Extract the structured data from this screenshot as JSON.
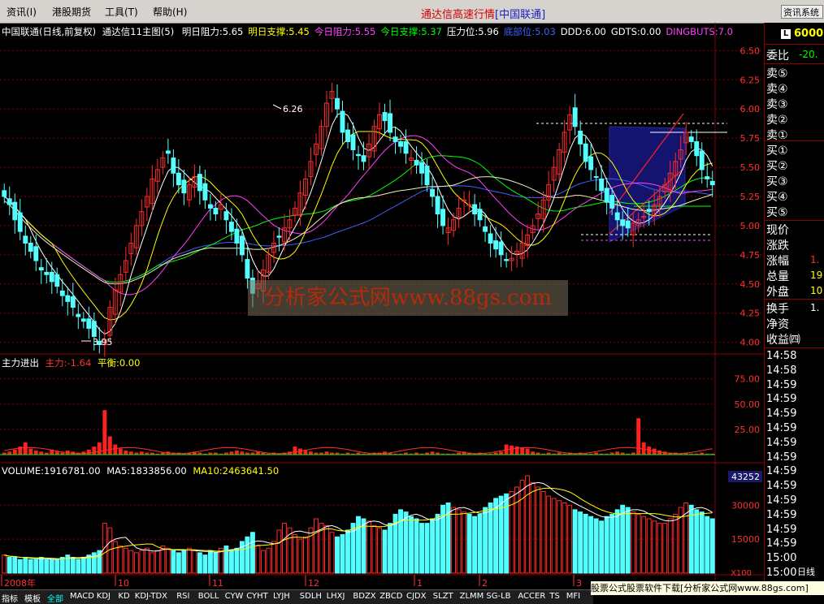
{
  "menubar": {
    "items": [
      "资讯(I)",
      "港股期货",
      "工具(T)",
      "帮助(H)"
    ],
    "title": "通达信高速行情",
    "code_label": "[中国联通]",
    "right_button": "资讯系统"
  },
  "main_header": {
    "stock": "中国联通(日线,前复权)",
    "indicator": "通达信11主图(5)",
    "items": [
      {
        "label": "明日阻力:5.65",
        "color": "#ffffff"
      },
      {
        "label": "明日支撑:5.45",
        "color": "#ffff00"
      },
      {
        "label": "今日阻力:5.55",
        "color": "#ff40ff"
      },
      {
        "label": "今日支撑:5.37",
        "color": "#00ff00"
      },
      {
        "label": "压力位:5.96",
        "color": "#ffffff"
      },
      {
        "label": "底部位:5.03",
        "color": "#4060ff"
      },
      {
        "label": "DDD:6.00",
        "color": "#ffffff"
      },
      {
        "label": "GDTS:0.00",
        "color": "#ffffff"
      },
      {
        "label": "DINGBUTS:7.0",
        "color": "#ff40ff"
      }
    ]
  },
  "price_axis": [
    "6.50",
    "6.25",
    "6.00",
    "5.75",
    "5.50",
    "5.25",
    "5.00",
    "4.75",
    "4.50",
    "4.25",
    "4.00"
  ],
  "annotations": {
    "high": "6.26",
    "low": "3.95"
  },
  "sub_header": {
    "name": "主力进出",
    "main_force": "主力:-1.64",
    "balance": "平衡:0.00"
  },
  "sub_axis": [
    "75.00",
    "50.00",
    "25.00"
  ],
  "vol_header": {
    "volume": "VOLUME:1916781.00",
    "ma5": "MA5:1833856.00",
    "ma10": "MA10:2463641.50"
  },
  "vol_axis": [
    "43252",
    "30000",
    "15000",
    "X100"
  ],
  "date_axis": [
    "2008年",
    "10",
    "11",
    "12",
    "1",
    "2",
    "3"
  ],
  "side_panel": {
    "code": "6000",
    "weibi_label": "委比",
    "weibi_value": "-20.",
    "sell": [
      "卖⑤",
      "卖④",
      "卖③",
      "卖②",
      "卖①"
    ],
    "buy": [
      "买①",
      "买②",
      "买③",
      "买④",
      "买⑤"
    ],
    "quote_labels": [
      "现价",
      "涨跌",
      "涨幅",
      "总量",
      "外盘"
    ],
    "quote_values": [
      "",
      "",
      "1.",
      "19",
      "10"
    ],
    "extra_labels": [
      "换手",
      "净资",
      "收益㈣"
    ],
    "extra_values": [
      "1.",
      "",
      ""
    ],
    "tick_times": [
      "14:58",
      "14:58",
      "14:59",
      "14:59",
      "14:59",
      "14:59",
      "14:59",
      "14:59",
      "14:59",
      "14:59",
      "14:59",
      "14:59",
      "14:59",
      "14:59",
      "15:00",
      "15:00"
    ],
    "date_label": "日线"
  },
  "bottom_tabs": [
    "指标",
    "模板",
    "全部",
    "MACD",
    "KDJ",
    "KD",
    "KDJ-TDX",
    "RSI",
    "BOLL",
    "CYW",
    "CYHT",
    "LYJH",
    "SDLH",
    "LHXJ",
    "BDZX",
    "ZBCD",
    "CJDX",
    "SLZT",
    "ZLMM",
    "SG-LB",
    "ACCER",
    "TS",
    "MFI"
  ],
  "ad_text": "股票公式股票软件下载[分析家公式网www.88gs.com]",
  "watermark": "分析家公式网www.88gs.com",
  "colors": {
    "up": "#ff2a2a",
    "down": "#54ffff",
    "ma5": "#ffffff",
    "ma10": "#ffff00",
    "ma20": "#ff40ff",
    "ma30": "#00ff00",
    "ma60": "#4060ff",
    "grid": "#8b0000"
  },
  "chart_data": {
    "type": "candlestick",
    "price_range": [
      3.9,
      6.6
    ],
    "closes": [
      5.25,
      5.18,
      5.05,
      4.95,
      4.85,
      4.78,
      4.7,
      4.62,
      4.58,
      4.52,
      4.48,
      4.4,
      4.35,
      4.3,
      4.22,
      4.18,
      4.12,
      4.05,
      3.98,
      4.02,
      4.3,
      4.45,
      4.58,
      4.7,
      4.85,
      5.0,
      5.12,
      5.25,
      5.4,
      5.48,
      5.58,
      5.62,
      5.45,
      5.35,
      5.28,
      5.35,
      5.42,
      5.3,
      5.22,
      5.15,
      5.1,
      5.18,
      5.05,
      4.95,
      4.85,
      4.75,
      4.55,
      4.42,
      4.5,
      4.62,
      4.75,
      4.85,
      4.9,
      4.98,
      5.05,
      5.15,
      5.28,
      5.4,
      5.55,
      5.7,
      5.85,
      6.05,
      6.15,
      6.0,
      5.8,
      5.72,
      5.65,
      5.6,
      5.55,
      5.7,
      5.85,
      5.95,
      5.9,
      5.8,
      5.72,
      5.68,
      5.62,
      5.58,
      5.52,
      5.45,
      5.35,
      5.25,
      5.1,
      5.0,
      4.98,
      5.05,
      5.15,
      5.22,
      5.18,
      5.1,
      5.05,
      4.95,
      4.85,
      4.8,
      4.75,
      4.7,
      4.72,
      4.78,
      4.85,
      4.92,
      5.0,
      5.1,
      5.22,
      5.35,
      5.5,
      5.65,
      5.8,
      5.95,
      5.85,
      5.7,
      5.55,
      5.48,
      5.42,
      5.3,
      5.2,
      5.15,
      5.05,
      5.0,
      4.98,
      5.02,
      5.05,
      5.08,
      5.12,
      5.18,
      5.25,
      5.35,
      5.45,
      5.55,
      5.65,
      5.8,
      5.72,
      5.6,
      5.48,
      5.4,
      5.35
    ],
    "mainforce": [
      2,
      3,
      5,
      8,
      12,
      6,
      4,
      3,
      2,
      5,
      3,
      2,
      4,
      3,
      2,
      3,
      5,
      8,
      12,
      44,
      18,
      10,
      6,
      4,
      3,
      2,
      3,
      2,
      2,
      1,
      2,
      3,
      2,
      2,
      1,
      2,
      3,
      2,
      1,
      2,
      2,
      1,
      2,
      3,
      4,
      3,
      2,
      2,
      3,
      2,
      1,
      2,
      1,
      2,
      3,
      8,
      6,
      4,
      3,
      2,
      2,
      3,
      2,
      2,
      1,
      2,
      1,
      2,
      1,
      1,
      2,
      2,
      3,
      2,
      1,
      1,
      2,
      1,
      2,
      1,
      2,
      3,
      2,
      1,
      1,
      1,
      2,
      3,
      2,
      1,
      2,
      1,
      1,
      2,
      3,
      10,
      9,
      8,
      7,
      6,
      3,
      2,
      1,
      2,
      1,
      2,
      1,
      2,
      1,
      2,
      1,
      1,
      2,
      1,
      1,
      2,
      3,
      2,
      1,
      2,
      36,
      12,
      8,
      6,
      4,
      3,
      2,
      2,
      1,
      2,
      1,
      1,
      2,
      1,
      1
    ],
    "volumes": [
      8,
      7,
      7,
      6,
      7,
      6,
      6,
      7,
      6,
      6,
      6,
      7,
      8,
      7,
      6,
      7,
      8,
      9,
      10,
      22,
      20,
      14,
      12,
      11,
      10,
      9,
      10,
      11,
      9,
      10,
      12,
      11,
      10,
      9,
      10,
      11,
      10,
      9,
      8,
      10,
      9,
      11,
      12,
      10,
      11,
      14,
      16,
      18,
      12,
      10,
      11,
      14,
      19,
      22,
      20,
      17,
      15,
      16,
      20,
      24,
      22,
      21,
      18,
      16,
      17,
      19,
      22,
      25,
      24,
      23,
      21,
      20,
      19,
      22,
      26,
      28,
      27,
      25,
      24,
      22,
      22,
      24,
      26,
      30,
      31,
      29,
      28,
      27,
      26,
      25,
      26,
      29,
      31,
      33,
      34,
      35,
      36,
      38,
      41,
      43,
      40,
      38,
      36,
      34,
      33,
      32,
      31,
      30,
      28,
      27,
      26,
      25,
      24,
      23,
      25,
      26,
      28,
      30,
      29,
      27,
      26,
      25,
      24,
      23,
      22,
      22,
      24,
      26,
      29,
      31,
      30,
      28,
      27,
      25,
      24
    ]
  }
}
